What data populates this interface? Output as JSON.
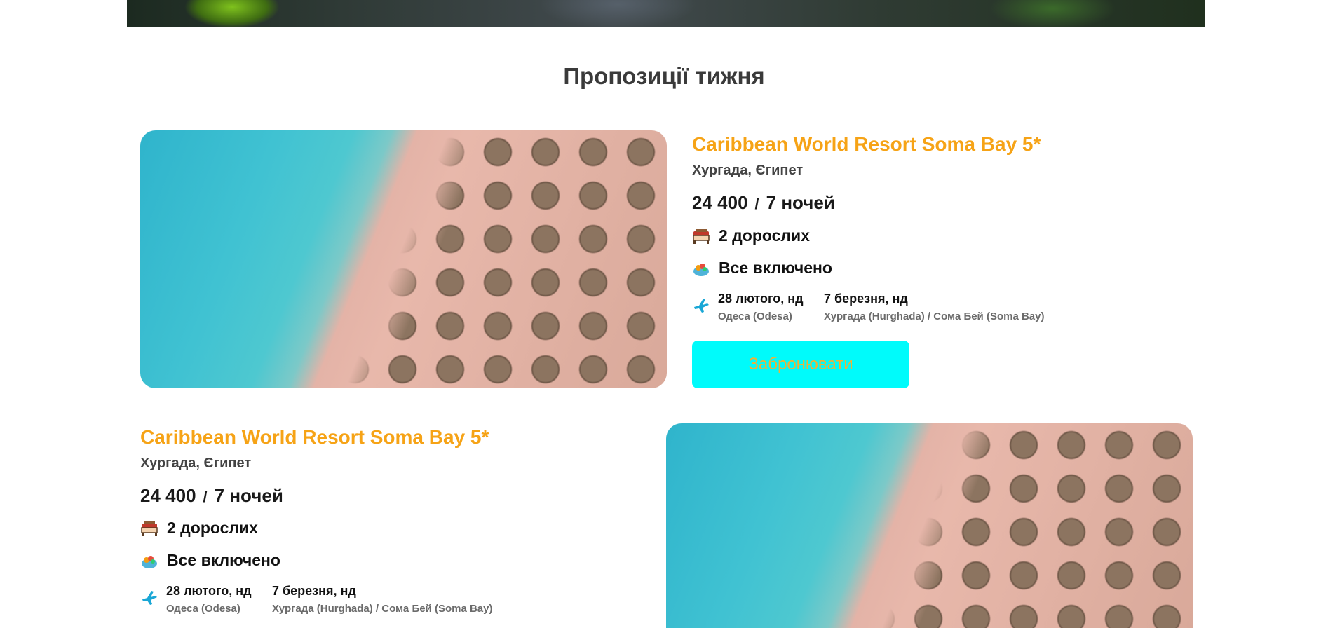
{
  "section": {
    "title": "Пропозиції тижня"
  },
  "offers": [
    {
      "hotel_name": "Caribbean World Resort Soma Bay 5*",
      "location": "Хургада, Єгипет",
      "price": "24 400",
      "separator": "/",
      "nights": "7 ночей",
      "guests": "2 дорослих",
      "meals": "Все включено",
      "depart_date": "28 лютого, нд",
      "depart_place": "Одеса (Odesa)",
      "return_date": "7 березня, нд",
      "return_place": "Хургада (Hurghada) / Сома Бей (Soma Bay)",
      "book_label": "Забронювати"
    },
    {
      "hotel_name": "Caribbean World Resort Soma Bay 5*",
      "location": "Хургада, Єгипет",
      "price": "24 400",
      "separator": "/",
      "nights": "7 ночей",
      "guests": "2 дорослих",
      "meals": "Все включено",
      "depart_date": "28 лютого, нд",
      "depart_place": "Одеса (Odesa)",
      "return_date": "7 березня, нд",
      "return_place": "Хургада (Hurghada) / Сома Бей (Soma Bay)"
    }
  ],
  "icons": {
    "guests": "bed-icon",
    "meals": "food-icon",
    "flight": "plane-icon"
  },
  "colors": {
    "accent_title": "#f6a316",
    "button_bg": "#00fbfb",
    "button_text": "#f2b034"
  }
}
